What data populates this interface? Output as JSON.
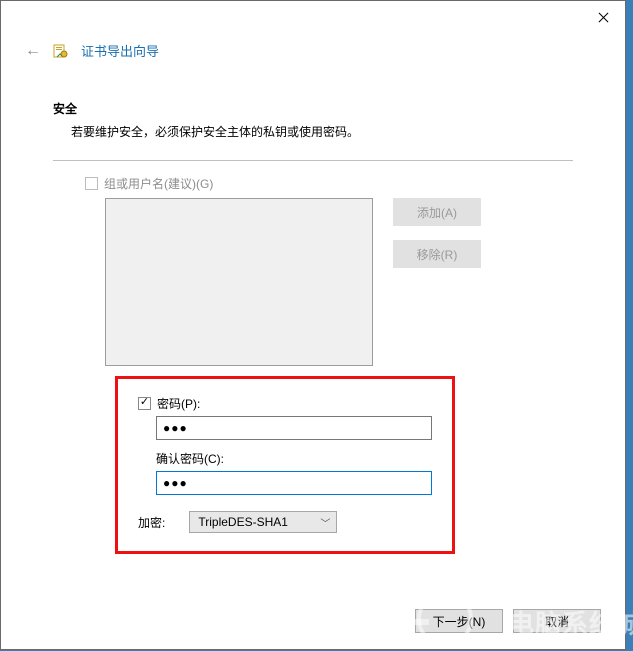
{
  "window": {
    "title": "证书导出向导"
  },
  "section": {
    "heading": "安全",
    "description": "若要维护安全，必须保护安全主体的私钥或使用密码。"
  },
  "groups": {
    "checkbox_label": "组或用户名(建议)(G)",
    "checked": false,
    "add_label": "添加(A)",
    "remove_label": "移除(R)"
  },
  "password": {
    "enable_label": "密码(P):",
    "checked": true,
    "value_mask": "●●●",
    "confirm_label": "确认密码(C):",
    "confirm_value_mask": "●●●"
  },
  "encryption": {
    "label": "加密:",
    "selected": "TripleDES-SHA1"
  },
  "footer": {
    "next": "下一步(N)",
    "cancel": "取消"
  }
}
